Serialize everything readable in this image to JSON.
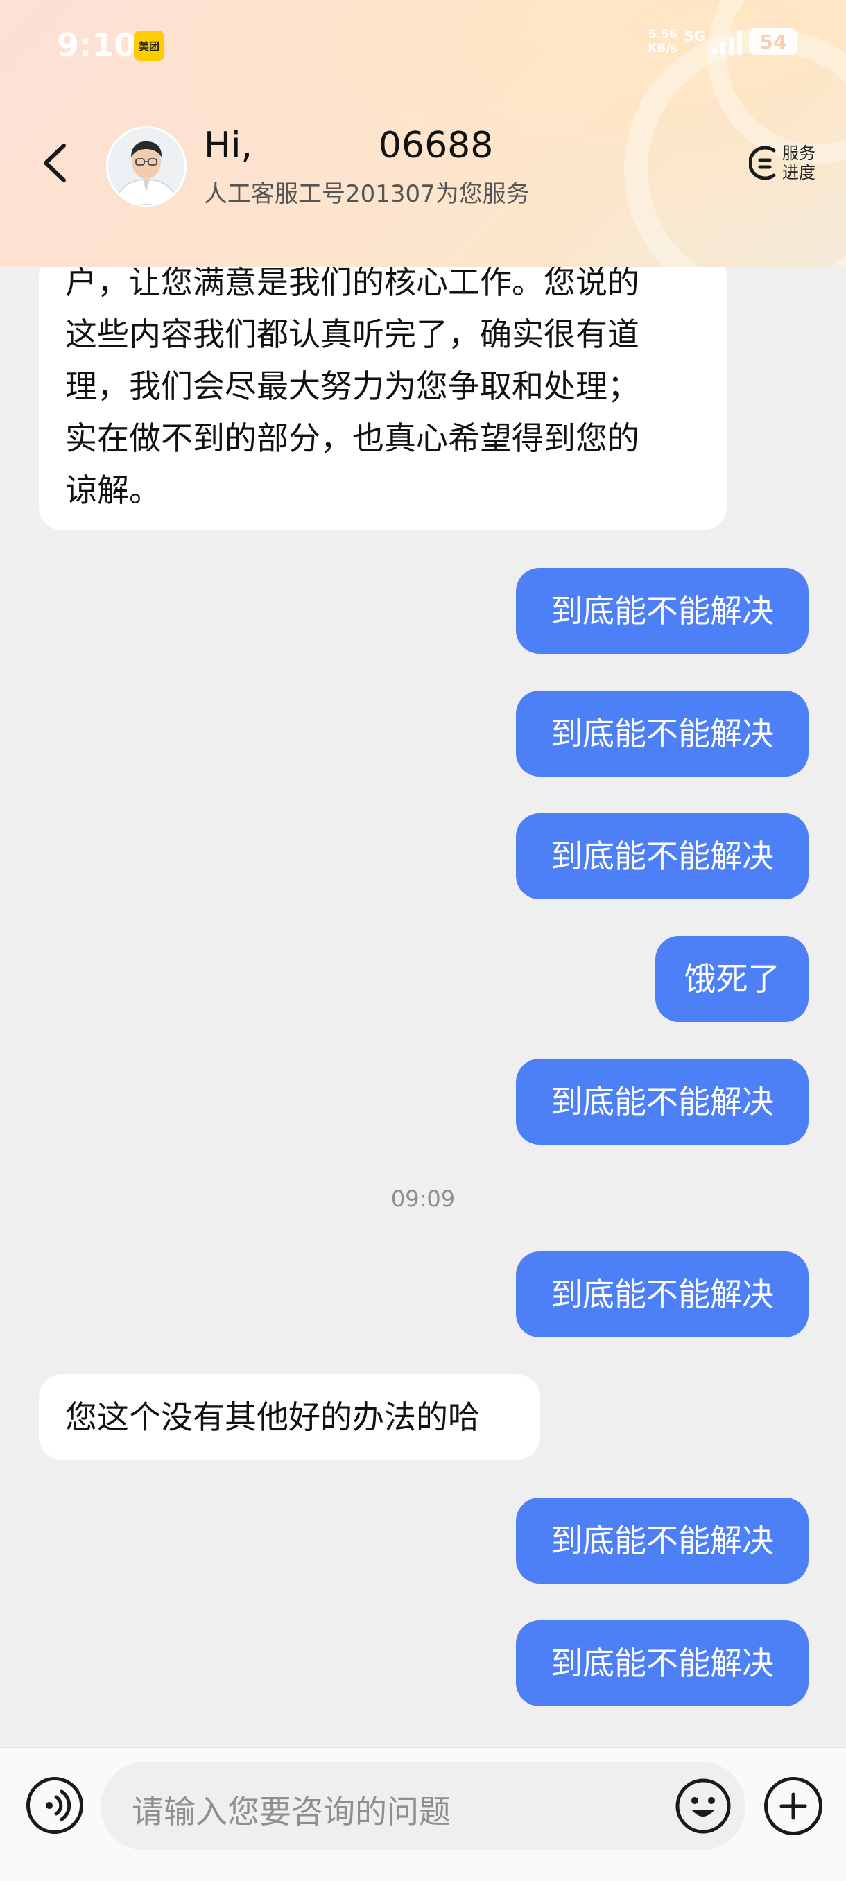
{
  "status_bar": {
    "time": "9:10",
    "app_badge_text": "美团",
    "net_speed_value": "5.56",
    "net_speed_unit": "KB/s",
    "network_type": "5G",
    "battery": "54"
  },
  "header": {
    "title": "Hi,           06688",
    "subtitle": "人工客服工号201307为您服务",
    "progress_label": "服务进度",
    "back_icon": "chevron-left-icon",
    "progress_icon": "clock-list-icon"
  },
  "messages": {
    "first_incoming": "户，让您满意是我们的核心工作。您说的\n这些内容我们都认真听完了，确实很有道\n理，我们会尽最大努力为您争取和处理；\n实在做不到的部分，也真心希望得到您的\n谅解。",
    "out_1": "到底能不能解决",
    "out_2": "到底能不能解决",
    "out_3": "到底能不能解决",
    "out_4": "饿死了",
    "out_5": "到底能不能解决",
    "timestamp": "09:09",
    "out_6": "到底能不能解决",
    "in_2": "您这个没有其他好的办法的哈",
    "out_7": "到底能不能解决",
    "out_8": "到底能不能解决"
  },
  "input_bar": {
    "placeholder": "请输入您要咨询的问题",
    "voice_icon": "voice-icon",
    "emoji_icon": "emoji-icon",
    "plus_icon": "plus-icon"
  },
  "colors": {
    "outgoing_bubble": "#4d7ff7",
    "incoming_bubble": "#ffffff",
    "chat_background": "#efefef"
  }
}
